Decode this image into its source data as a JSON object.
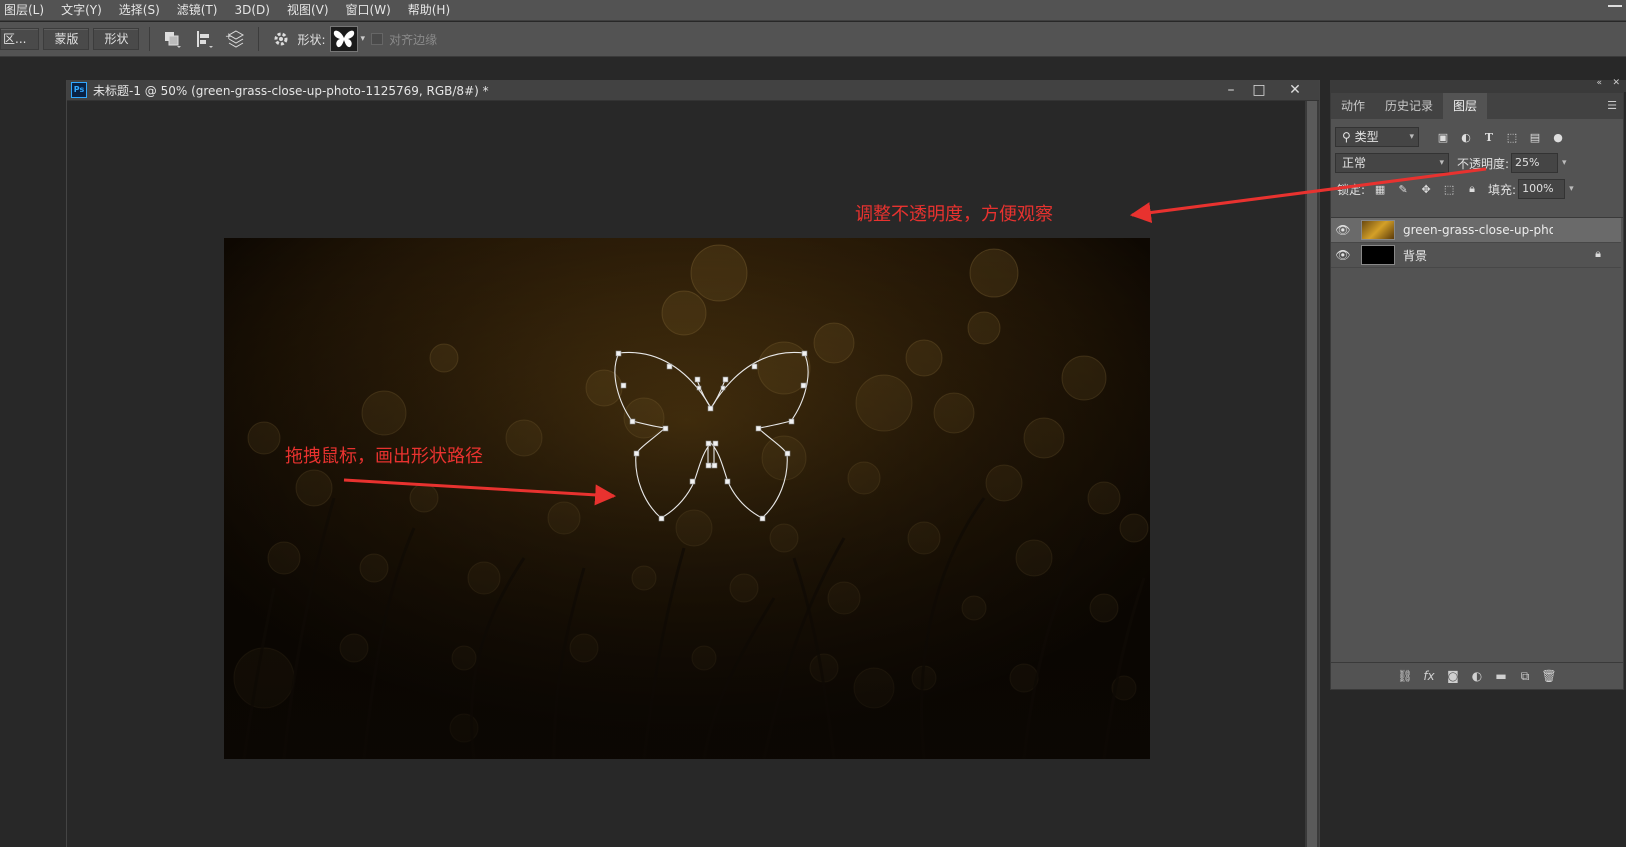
{
  "menubar": {
    "items": [
      "图层(L)",
      "文字(Y)",
      "选择(S)",
      "滤镜(T)",
      "3D(D)",
      "视图(V)",
      "窗口(W)",
      "帮助(H)"
    ]
  },
  "options_bar": {
    "selection_btn": "区...",
    "mask_btn": "蒙版",
    "shape_btn": "形状",
    "shape_label": "形状:",
    "align_edges_label": "对齐边缘"
  },
  "document": {
    "title": "未标题-1 @ 50% (green-grass-close-up-photo-1125769, RGB/8#) *",
    "ps_badge": "Ps"
  },
  "annotations": {
    "opacity_note": "调整不透明度，方便观察",
    "drag_note": "拖拽鼠标，画出形状路径"
  },
  "panel": {
    "tabs": [
      "动作",
      "历史记录",
      "图层"
    ],
    "active_tab": "图层",
    "filter_kind": "类型",
    "blend_mode": "正常",
    "opacity_label": "不透明度:",
    "opacity_value": "25%",
    "lock_label": "锁定:",
    "fill_label": "填充:",
    "fill_value": "100%",
    "layers": [
      {
        "name": "green-grass-close-up-pho...",
        "visible": true,
        "selected": true
      },
      {
        "name": "背景",
        "visible": true,
        "selected": false,
        "locked": true
      }
    ]
  },
  "colors": {
    "annotation": "#e8322f",
    "ui_dark": "#282828",
    "ui_panel": "#535353"
  }
}
